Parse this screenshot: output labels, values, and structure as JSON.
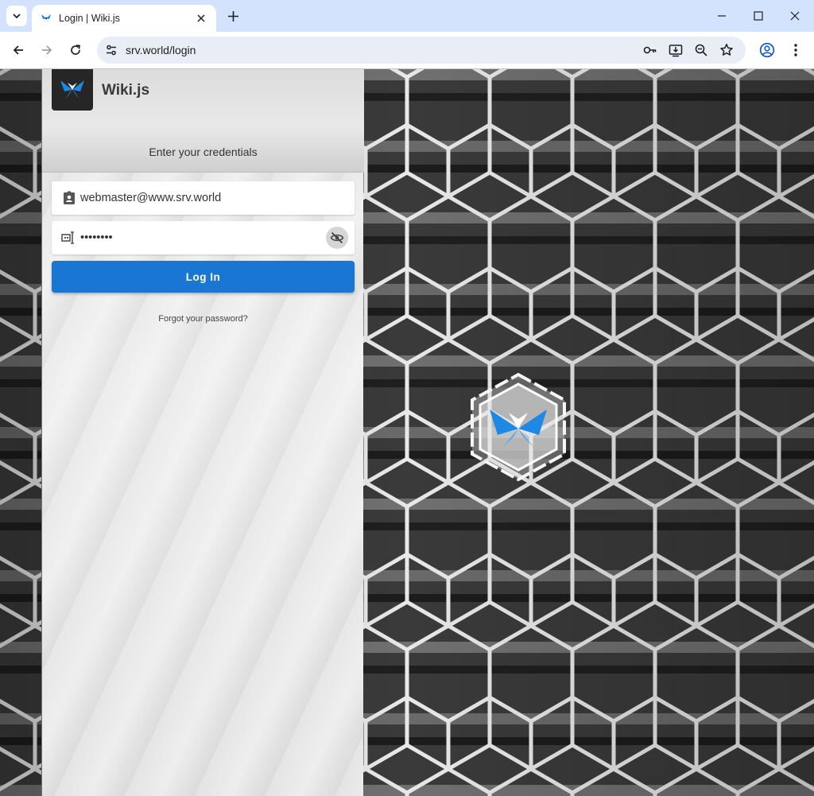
{
  "browser": {
    "tab_title": "Login | Wiki.js",
    "url": "srv.world/login",
    "icons": [
      "tab-search-icon",
      "wikijs-favicon-icon",
      "close-icon",
      "plus-icon",
      "minimize-icon",
      "maximize-icon",
      "close-window-icon",
      "back-icon",
      "forward-icon",
      "reload-icon",
      "site-info-icon",
      "password-key-icon",
      "install-app-icon",
      "zoom-icon",
      "star-icon",
      "profile-icon",
      "more-menu-icon"
    ]
  },
  "page": {
    "app_name": "Wiki.js",
    "subtitle": "Enter your credentials",
    "email": {
      "value": "webmaster@www.srv.world",
      "icon": "contact-card-icon"
    },
    "password": {
      "value": "••••••••",
      "icon": "password-field-icon",
      "toggle_icon": "eye-off-icon"
    },
    "login_label": "Log In",
    "forgot_label": "Forgot your password?"
  },
  "colors": {
    "primary": "#1976d2",
    "chrome_bg": "#d3e3fd",
    "omnibox_bg": "#e9eef6"
  }
}
